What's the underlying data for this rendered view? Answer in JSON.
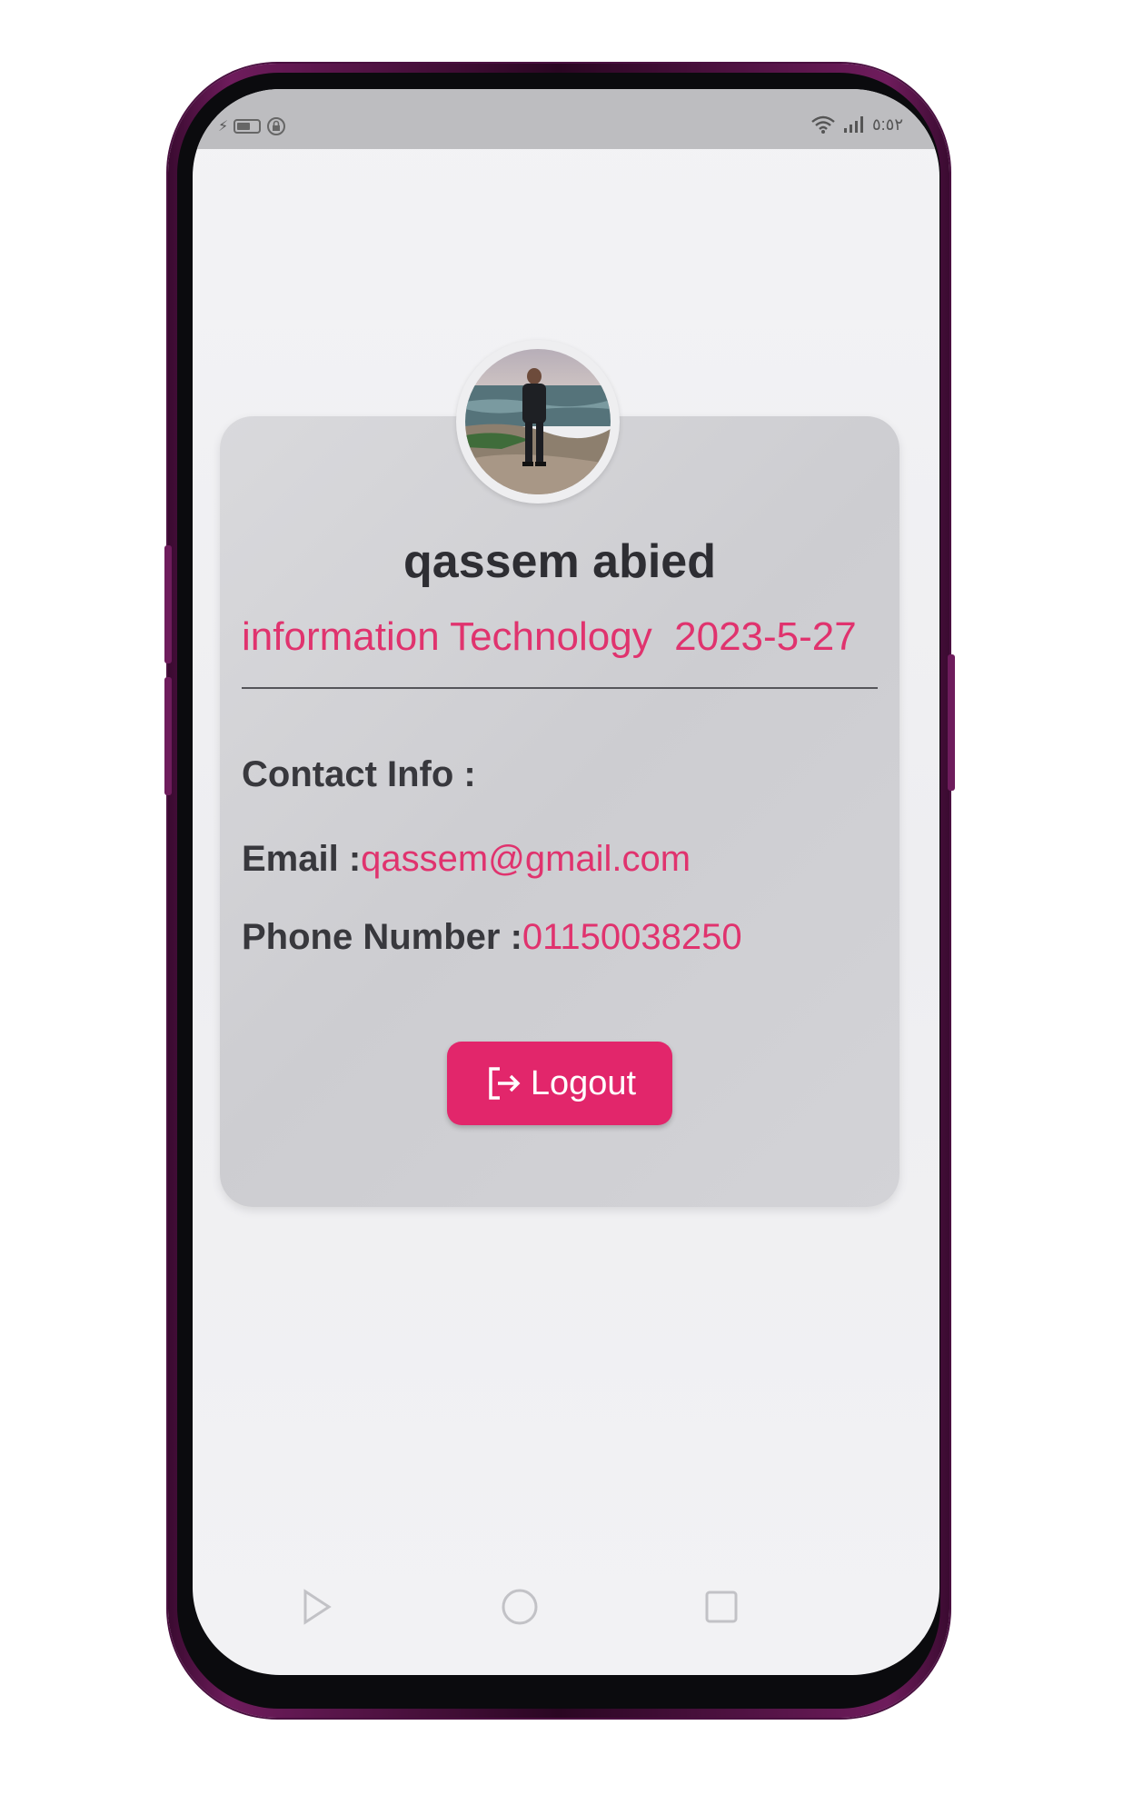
{
  "status_bar": {
    "time": "٥:٥٢",
    "icons": [
      "usb-icon",
      "battery-icon",
      "lock-rotation-icon",
      "wifi-icon",
      "signal-icon"
    ]
  },
  "profile": {
    "avatar_alt": "profile-photo",
    "name": "qassem abied",
    "subtitle": "information Technology  2023-5-27"
  },
  "contact": {
    "heading": "Contact Info :",
    "email_label": "Email :",
    "email_value": "qassem@gmail.com",
    "phone_label": "Phone Number :",
    "phone_value": "01150038250"
  },
  "actions": {
    "logout_label": "Logout",
    "logout_icon": "logout-icon"
  },
  "nav": {
    "items": [
      "back-triangle-icon",
      "home-circle-icon",
      "recents-square-icon"
    ]
  },
  "colors": {
    "accent": "#e2266b",
    "accent_text": "#e0336e",
    "frame": "#6e1c5c"
  }
}
